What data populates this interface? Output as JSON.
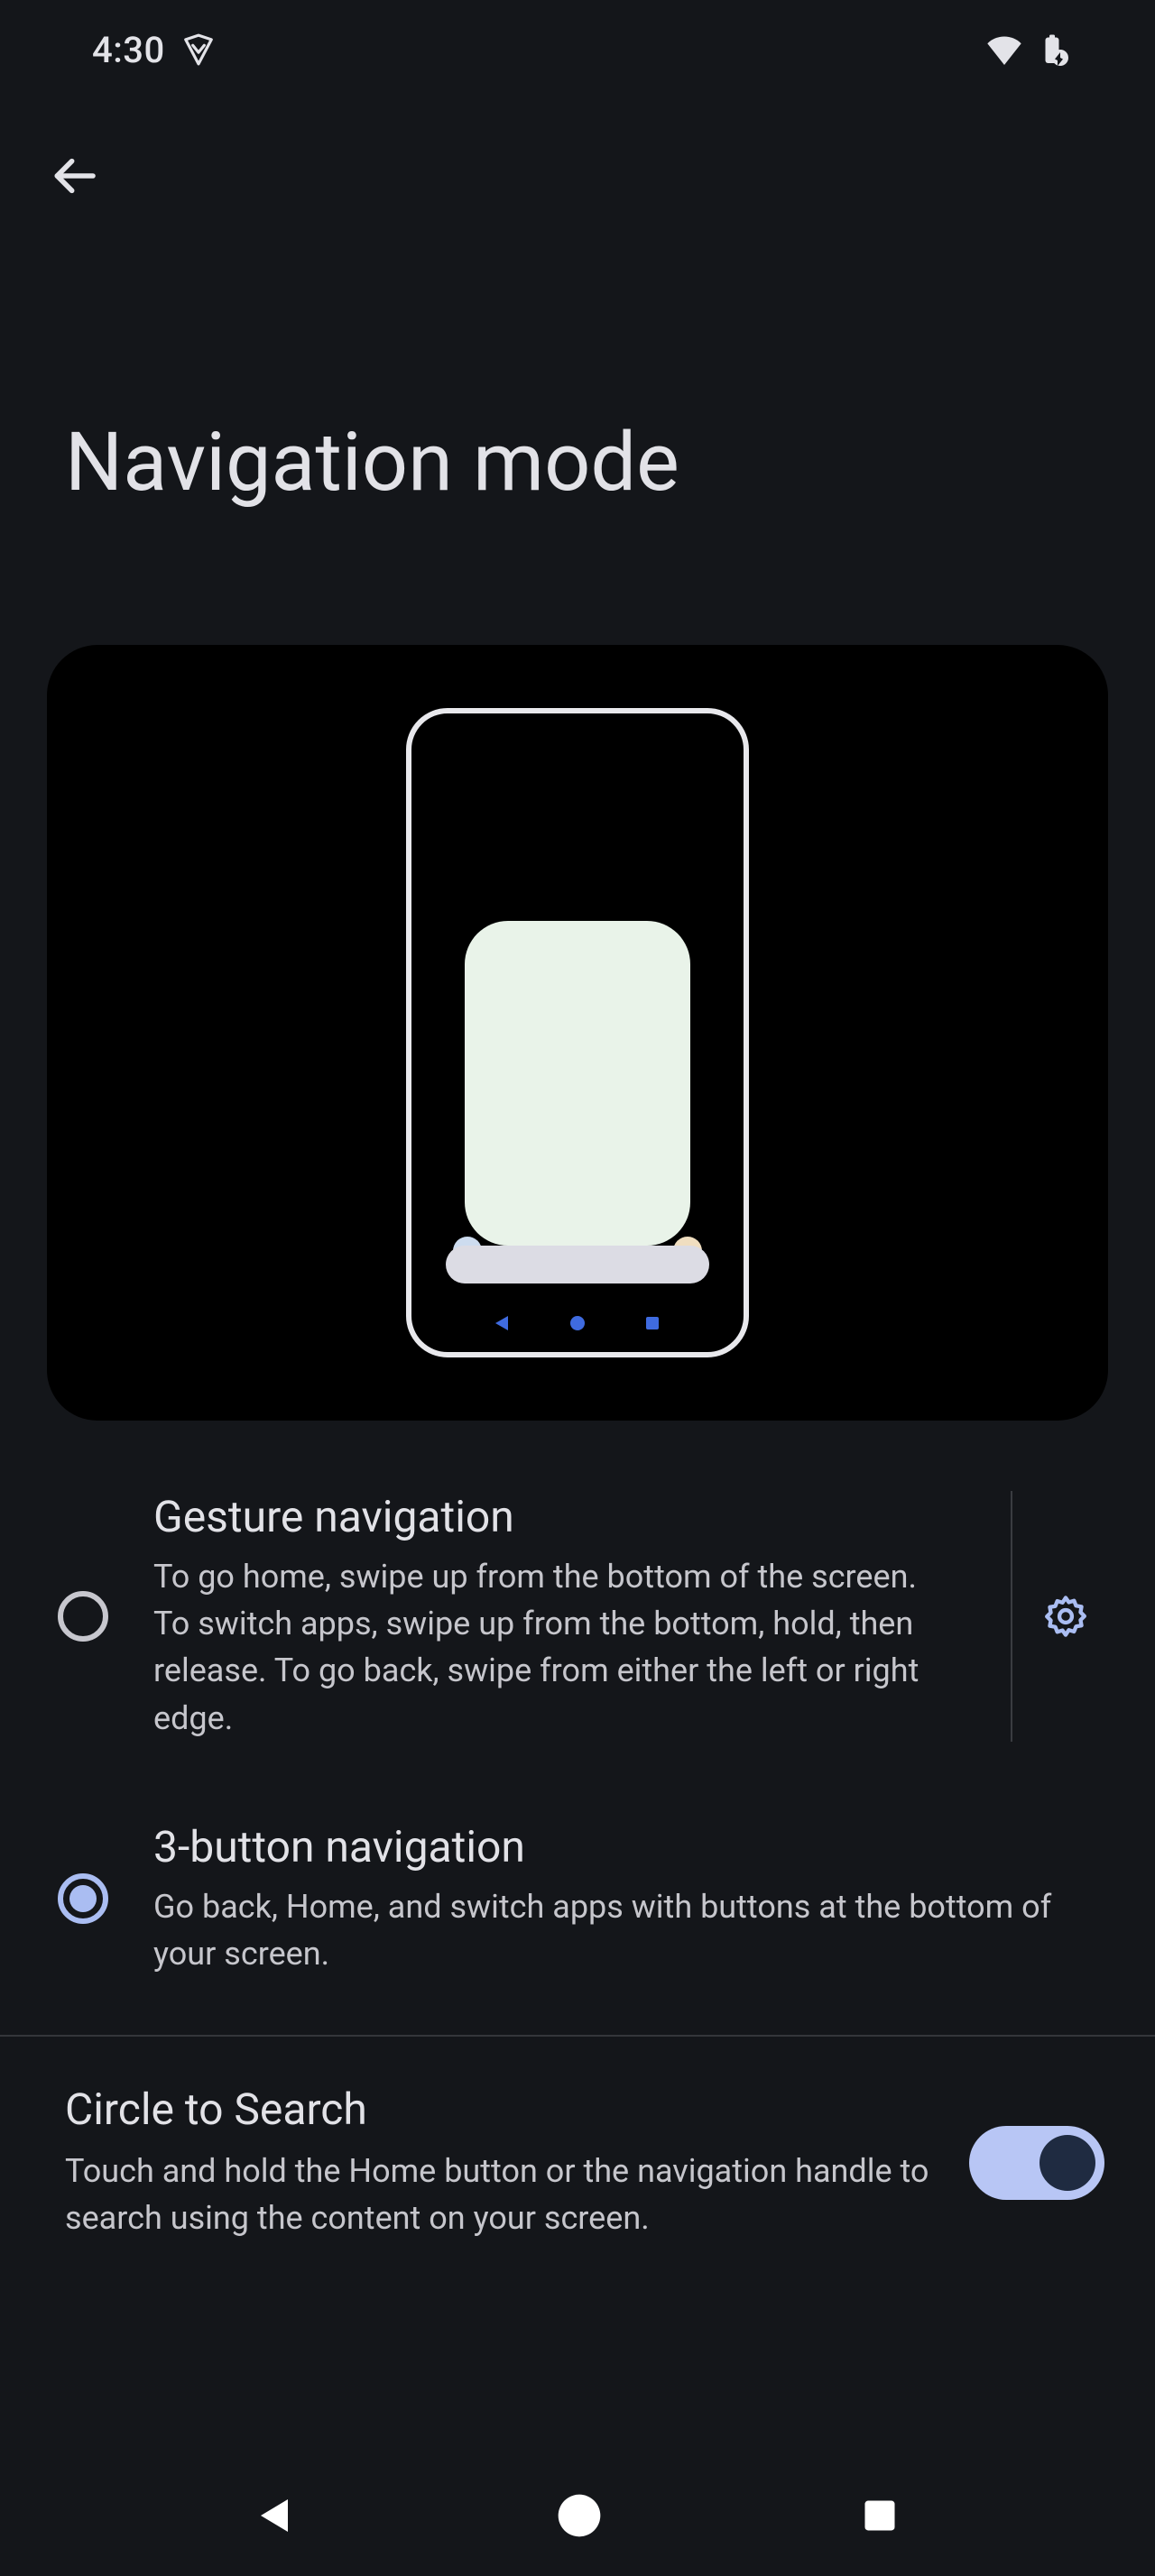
{
  "status_bar": {
    "time": "4:30"
  },
  "page": {
    "title": "Navigation mode"
  },
  "options": {
    "gesture": {
      "title": "Gesture navigation",
      "description": "To go home, swipe up from the bottom of the screen. To switch apps, swipe up from the bottom, hold, then release. To go back, swipe from either the left or right edge.",
      "selected": false,
      "has_settings": true
    },
    "three_button": {
      "title": "3-button navigation",
      "description": "Go back, Home, and switch apps with buttons at the bottom of your screen.",
      "selected": true
    }
  },
  "circle_to_search": {
    "title": "Circle to Search",
    "description": "Touch and hold the Home button or the navigation handle to search using the content on your screen.",
    "enabled": true
  },
  "colors": {
    "background": "#14161a",
    "text_primary": "#e2e2e7",
    "text_secondary": "#c6c6cc",
    "accent": "#aabdf2",
    "switch_track": "#b8c6f5",
    "switch_thumb": "#1f2b41"
  }
}
